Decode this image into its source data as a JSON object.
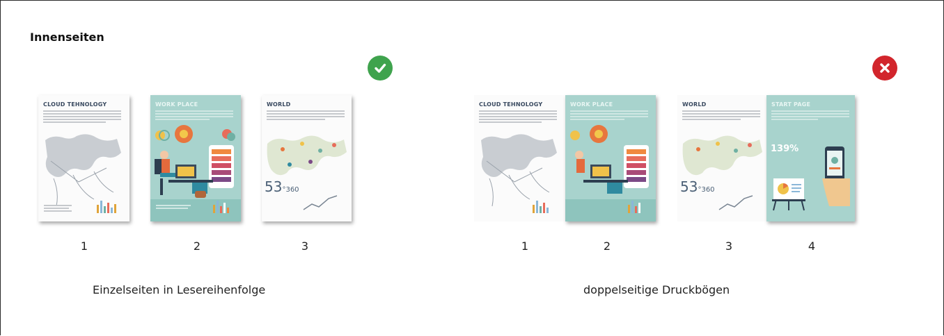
{
  "section": {
    "title": "Innenseiten"
  },
  "left_group": {
    "status_icon": "check-icon",
    "status_color": "#3fa34d",
    "pages": [
      {
        "number": "1",
        "heading": "CLOUD TEHNOLOGY"
      },
      {
        "number": "2",
        "heading": "WORK PLACE"
      },
      {
        "number": "3",
        "heading": "WORLD",
        "stat": "53",
        "stat_sup": "°360"
      }
    ],
    "caption": "Einzelseiten in Lesereihenfolge"
  },
  "right_group": {
    "status_icon": "x-icon",
    "status_color": "#d2252c",
    "pages": [
      {
        "number": "1",
        "heading": "CLOUD TEHNOLOGY"
      },
      {
        "number": "2",
        "heading": "WORK PLACE"
      },
      {
        "number": "3",
        "heading": "WORLD",
        "stat": "53",
        "stat_sup": "°360"
      },
      {
        "number": "4",
        "heading": "START PAGE",
        "percent": "139%"
      }
    ],
    "caption": "doppelseitige Druckbögen"
  }
}
